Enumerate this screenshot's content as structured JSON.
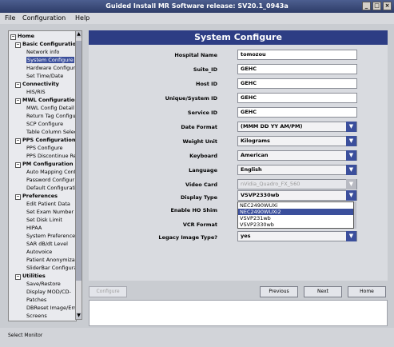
{
  "window": {
    "title": "Guided Install  MR Software release: SV20.1_0943a"
  },
  "menu": {
    "file": "File",
    "configuration": "Configuration",
    "help": "Help"
  },
  "tree": [
    {
      "label": "Home",
      "toggle": "⊟",
      "kind": "cat",
      "indent": 0
    },
    {
      "label": "Basic Configuration",
      "toggle": "⊟",
      "kind": "cat",
      "indent": 1
    },
    {
      "label": "Network info",
      "kind": "leaf",
      "indent": 2
    },
    {
      "label": "System Configure",
      "kind": "leaf",
      "indent": 2,
      "selected": true
    },
    {
      "label": "Hardware Configure",
      "kind": "leaf",
      "indent": 2
    },
    {
      "label": "Set Time/Date",
      "kind": "leaf",
      "indent": 2
    },
    {
      "label": "Connectivity",
      "toggle": "⊟",
      "kind": "cat",
      "indent": 1
    },
    {
      "label": "HIS/RIS",
      "kind": "leaf",
      "indent": 2
    },
    {
      "label": "MWL Configuration",
      "toggle": "⊟",
      "kind": "cat",
      "indent": 1
    },
    {
      "label": "MWL Config Detail",
      "kind": "leaf",
      "indent": 2
    },
    {
      "label": "Return Tag Configur",
      "kind": "leaf",
      "indent": 2
    },
    {
      "label": "SCP Configure",
      "kind": "leaf",
      "indent": 2
    },
    {
      "label": "Table Column Selec",
      "kind": "leaf",
      "indent": 2
    },
    {
      "label": "PPS Configuration",
      "toggle": "⊟",
      "kind": "cat",
      "indent": 1
    },
    {
      "label": "PPS Configure",
      "kind": "leaf",
      "indent": 2
    },
    {
      "label": "PPS Discontinue Re",
      "kind": "leaf",
      "indent": 2
    },
    {
      "label": "PM Configuration",
      "toggle": "⊟",
      "kind": "cat",
      "indent": 1
    },
    {
      "label": "Auto Mapping Conf",
      "kind": "leaf",
      "indent": 2
    },
    {
      "label": "Password Configur",
      "kind": "leaf",
      "indent": 2
    },
    {
      "label": "Default Configurati",
      "kind": "leaf",
      "indent": 2
    },
    {
      "label": "Preferences",
      "toggle": "⊟",
      "kind": "cat",
      "indent": 1
    },
    {
      "label": "Edit Patient Data",
      "kind": "leaf",
      "indent": 2
    },
    {
      "label": "Set Exam Number",
      "kind": "leaf",
      "indent": 2
    },
    {
      "label": "Set Disk Limit",
      "kind": "leaf",
      "indent": 2
    },
    {
      "label": "HIPAA",
      "kind": "leaf",
      "indent": 2
    },
    {
      "label": "System Preferences",
      "kind": "leaf",
      "indent": 2
    },
    {
      "label": "SAR dB/dt Level",
      "kind": "leaf",
      "indent": 2
    },
    {
      "label": "Autovoice",
      "kind": "leaf",
      "indent": 2
    },
    {
      "label": "Patient Anonymizat",
      "kind": "leaf",
      "indent": 2
    },
    {
      "label": "SliderBar Configura",
      "kind": "leaf",
      "indent": 2
    },
    {
      "label": "Utilities",
      "toggle": "⊟",
      "kind": "cat",
      "indent": 1
    },
    {
      "label": "Save/Restore",
      "kind": "leaf",
      "indent": 2
    },
    {
      "label": "Display MOD/CD-",
      "kind": "leaf",
      "indent": 2
    },
    {
      "label": "Patches",
      "kind": "leaf",
      "indent": 2
    },
    {
      "label": "DBReset Image/Err",
      "kind": "leaf",
      "indent": 2
    },
    {
      "label": "Screens",
      "kind": "leaf",
      "indent": 2
    }
  ],
  "panel": {
    "title": "System Configure",
    "hospital_name": {
      "label": "Hospital Name",
      "value": "tomozou"
    },
    "suite_id": {
      "label": "Suite_ID",
      "value": "GEHC"
    },
    "host_id": {
      "label": "Host ID",
      "value": "GEHC"
    },
    "unique_system_id": {
      "label": "Unique/System ID",
      "value": "GEHC"
    },
    "service_id": {
      "label": "Service ID",
      "value": "GEHC"
    },
    "date_format": {
      "label": "Date Format",
      "value": "(MMM DD YY AM/PM)"
    },
    "weight_unit": {
      "label": "Weight Unit",
      "value": "Kilograms"
    },
    "keyboard": {
      "label": "Keyboard",
      "value": "American"
    },
    "language": {
      "label": "Language",
      "value": "English"
    },
    "video_card": {
      "label": "Video Card",
      "value": "nVidia_Quadro_FX_560"
    },
    "display_type": {
      "label": "Display Type",
      "value": "VSVP2330wb",
      "options": [
        "NEC2490WUXi",
        "NEC2490WUXi2",
        "VSVP231wb",
        "VSVP2330wb"
      ],
      "highlighted": "NEC2490WUXi2"
    },
    "enable_ho_shim": {
      "label": "Enable HO Shim"
    },
    "vcr_format": {
      "label": "VCR Format"
    },
    "legacy_image_type": {
      "label": "Legacy Image Type?",
      "value": "yes"
    }
  },
  "buttons": {
    "configure": "Configure",
    "previous": "Previous",
    "next": "Next",
    "home": "Home"
  },
  "status": {
    "text": "Select Monitor"
  },
  "icons": {
    "dropdown": "chevron-down-icon",
    "tree_toggle": "collapse-icon"
  },
  "colors": {
    "accent": "#2d3d84",
    "selection": "#3b4f9c"
  }
}
